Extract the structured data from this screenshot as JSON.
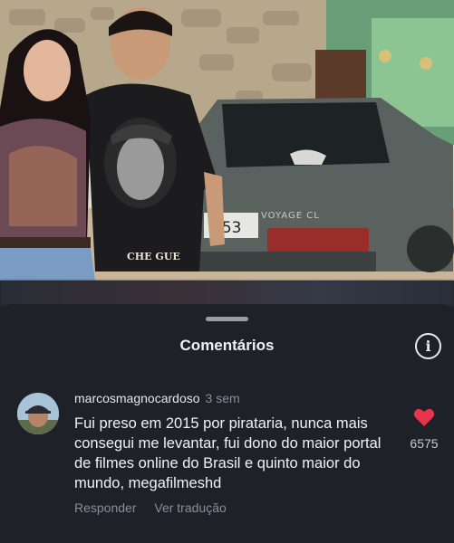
{
  "photo": {
    "plate_text": "353",
    "shirt_text": "CHE GUE",
    "car_badge": "VOYAGE CL"
  },
  "sheet": {
    "title": "Comentários",
    "info_icon": "info-icon",
    "info_glyph": "i"
  },
  "comment": {
    "username": "marcosmagnocardoso",
    "time": "3 sem",
    "text": "Fui preso em 2015 por pirataria, nunca mais consegui me levantar, fui dono do maior portal de filmes online do Brasil e quinto maior do mundo, megafilmeshd",
    "reply_label": "Responder",
    "translate_label": "Ver tradução",
    "like_count": "6575",
    "like_icon": "heart-icon",
    "like_color": "#e8334a"
  },
  "colors": {
    "background": "#1f2129",
    "text": "#f2f2f4",
    "muted": "#8b8e96"
  }
}
